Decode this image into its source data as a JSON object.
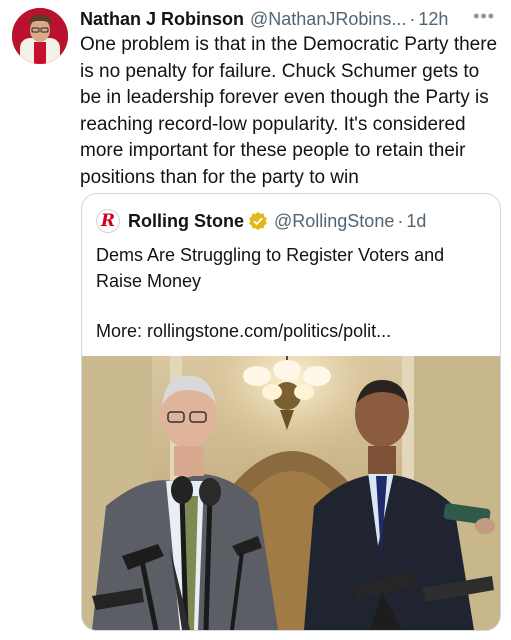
{
  "author": {
    "name": "Nathan J Robinson",
    "handle": "@NathanJRobins...",
    "separator": "·",
    "time": "12h",
    "more_icon": "ellipsis-icon"
  },
  "tweet": {
    "text": "One problem is that in the Democratic Party there is no penalty for failure. Chuck Schumer gets to be in leadership forever even though the Party is reaching record-low popularity. It's considered more important for these people to retain their positions than for the party to win"
  },
  "quote": {
    "logo_letter": "R",
    "name": "Rolling Stone",
    "handle": "@RollingStone",
    "separator": "·",
    "time": "1d",
    "text": "Dems Are Struggling to Register Voters and Raise Money",
    "more_link": "More: rollingstone.com/politics/polit...",
    "verified_color": "#e2b719",
    "brand_color": "#d0021b"
  }
}
